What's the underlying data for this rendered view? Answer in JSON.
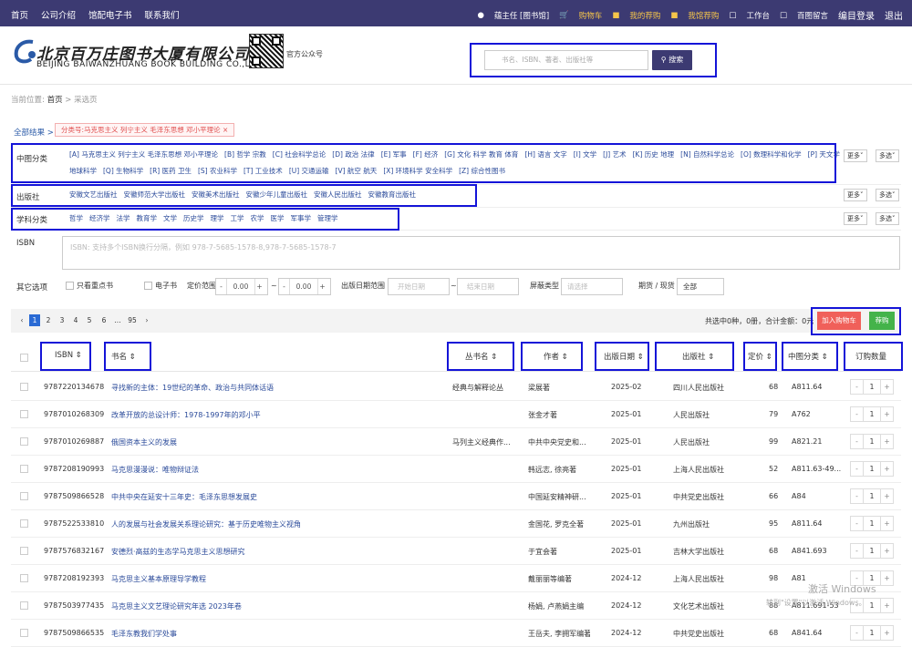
{
  "topbar": {
    "nav": [
      "首页",
      "公司介绍",
      "馆配电子书",
      "联系我们"
    ],
    "user": "蕴主任 [图书馆]",
    "cart": "购物车",
    "my_order": "我的荐购",
    "lib_order": "我馆荐购",
    "workbench": "工作台",
    "message": "百图留言",
    "edit_login": "编目登录",
    "logout": "退出"
  },
  "brand": {
    "cn": "北京百万庄图书大厦有限公司",
    "en": "BEIJING BAIWANZHUANG BOOK BUILDING CO.,LTD.",
    "qr_label": "官方公众号"
  },
  "search": {
    "placeholder": "书名、ISBN、著者、出版社等",
    "button": "搜索"
  },
  "breadcrumb": {
    "prefix": "当前位置:",
    "home": "首页",
    "sep": ">",
    "current": "采选页"
  },
  "filters": {
    "all_results": "全部结果 >",
    "active_tag": "分类号:马克思主义 列宁主义 毛泽东思想 邓小平理论  ×",
    "clc_label": "中图分类",
    "clc_line1": [
      "[A] 马克思主义 列宁主义 毛泽东思想 邓小平理论",
      "[B] 哲学 宗教",
      "[C] 社会科学总论",
      "[D] 政治 法律",
      "[E] 军事",
      "[F] 经济",
      "[G] 文化 科学 教育 体育",
      "[H] 语言 文字",
      "[I] 文学",
      "[J] 艺术",
      "[K] 历史 地理",
      "[N] 自然科学总论",
      "[O] 数理科学和化学",
      "[P] 天文学"
    ],
    "clc_line2": [
      "地球科学",
      "[Q] 生物科学",
      "[R] 医药 卫生",
      "[S] 农业科学",
      "[T] 工业技术",
      "[U] 交通运输",
      "[V] 航空 航天",
      "[X] 环境科学 安全科学",
      "[Z] 综合性图书"
    ],
    "pub_label": "出版社",
    "publishers": [
      "安徽文艺出版社",
      "安徽师范大学出版社",
      "安徽美术出版社",
      "安徽少年儿童出版社",
      "安徽人民出版社",
      "安徽教育出版社"
    ],
    "subj_label": "学科分类",
    "subjects": [
      "哲学",
      "经济学",
      "法学",
      "教育学",
      "文学",
      "历史学",
      "理学",
      "工学",
      "农学",
      "医学",
      "军事学",
      "管理学"
    ],
    "more": "更多",
    "multi": "多选",
    "isbn_label": "ISBN",
    "isbn_placeholder": "ISBN: 支持多个ISBN换行分隔，例如 978-7-5685-1578-8,978-7-5685-1578-7",
    "other_label": "其它选项",
    "only_key": "只看重点书",
    "ebook": "电子书",
    "price_range": "定价范围",
    "price_min": "0.00",
    "price_max": "0.00",
    "pub_date_range": "出版日期范围",
    "start_date": "开始日期",
    "end_date": "结束日期",
    "shield_type": "屏蔽类型",
    "shield_placeholder": "请选择",
    "period": "期货 / 现货",
    "period_value": "全部"
  },
  "pager": {
    "pages": [
      "1",
      "2",
      "3",
      "4",
      "5",
      "6",
      "...",
      "95"
    ],
    "active": "1",
    "totals": "共选中0种，0册，合计金额：0元",
    "add_cart": "加入购物车",
    "recommend": "荐购"
  },
  "table": {
    "headers": [
      "ISBN",
      "书名",
      "丛书名",
      "作者",
      "出版日期",
      "出版社",
      "定价",
      "中图分类",
      "订购数量"
    ],
    "rows": [
      {
        "isbn": "9787220134678",
        "title": "寻找新的主体：19世纪的革命、政治与共同体话语",
        "series": "经典与解释论丛",
        "author": "梁展著",
        "date": "2025-02",
        "publisher": "四川人民出版社",
        "price": "68",
        "clc": "A811.64",
        "qty": "1"
      },
      {
        "isbn": "9787010268309",
        "title": "改革开放的总设计师：1978-1997年的邓小平",
        "series": "",
        "author": "张金才著",
        "date": "2025-01",
        "publisher": "人民出版社",
        "price": "79",
        "clc": "A762",
        "qty": "1"
      },
      {
        "isbn": "9787010269887",
        "title": "俄国资本主义的发展",
        "series": "马列主义经典作...",
        "author": "中共中央党史和...",
        "date": "2025-01",
        "publisher": "人民出版社",
        "price": "99",
        "clc": "A821.21",
        "qty": "1"
      },
      {
        "isbn": "9787208190993",
        "title": "马克思漫漫说：唯物辩证法",
        "series": "",
        "author": "韩远志, 徐亮著",
        "date": "2025-01",
        "publisher": "上海人民出版社",
        "price": "52",
        "clc": "A811.63-49...",
        "qty": "1"
      },
      {
        "isbn": "9787509866528",
        "title": "中共中央在延安十三年史：毛泽东思想发展史",
        "series": "",
        "author": "中国延安精神研...",
        "date": "2025-01",
        "publisher": "中共党史出版社",
        "price": "66",
        "clc": "A84",
        "qty": "1"
      },
      {
        "isbn": "9787522533810",
        "title": "人的发展与社会发展关系理论研究：基于历史唯物主义视角",
        "series": "",
        "author": "金国花, 罗克全著",
        "date": "2025-01",
        "publisher": "九州出版社",
        "price": "95",
        "clc": "A811.64",
        "qty": "1"
      },
      {
        "isbn": "9787576832167",
        "title": "安德烈·高兹的生态学马克思主义思想研究",
        "series": "",
        "author": "于宜会著",
        "date": "2025-01",
        "publisher": "吉林大学出版社",
        "price": "68",
        "clc": "A841.693",
        "qty": "1"
      },
      {
        "isbn": "9787208192393",
        "title": "马克思主义基本原理导学教程",
        "series": "",
        "author": "戴丽丽等编著",
        "date": "2024-12",
        "publisher": "上海人民出版社",
        "price": "98",
        "clc": "A81",
        "qty": "1"
      },
      {
        "isbn": "9787503977435",
        "title": "马克思主义文艺理论研究年选 2023年卷",
        "series": "",
        "author": "杨娟, 卢燕娟主编",
        "date": "2024-12",
        "publisher": "文化艺术出版社",
        "price": "88",
        "clc": "A811.691-53",
        "qty": "1"
      },
      {
        "isbn": "9787509866535",
        "title": "毛泽东教我们学处事",
        "series": "",
        "author": "王岳夫, 李拥军编著",
        "date": "2024-12",
        "publisher": "中共党史出版社",
        "price": "68",
        "clc": "A841.64",
        "qty": "1"
      }
    ]
  },
  "watermark": {
    "line1": "激活 Windows",
    "line2": "转到\"设置\"以激活 Windows。"
  },
  "colors": {
    "topbar": "#3c3a72",
    "highlight_box": "#1414d8",
    "accent_gold": "#f5c54a",
    "add_cart": "#f0605a",
    "recommend": "#44b34a",
    "link": "#2a4a9a"
  }
}
